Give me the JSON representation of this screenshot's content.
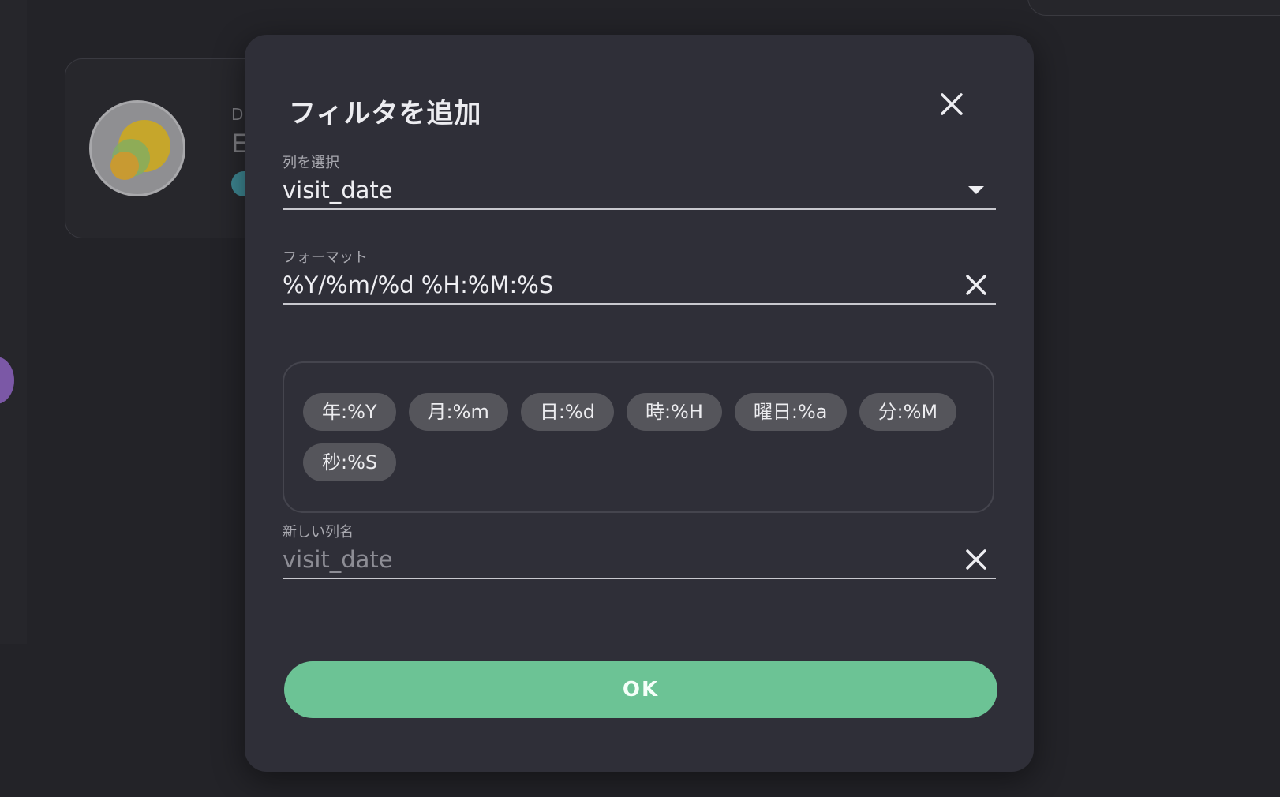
{
  "background": {
    "card_text_a": "D",
    "card_text_b": "E"
  },
  "dialog": {
    "title": "フィルタを追加",
    "close_icon": "close-icon",
    "column_field": {
      "label": "列を選択",
      "value": "visit_date",
      "icon": "dropdown-arrow-icon"
    },
    "format_field": {
      "label": "フォーマット",
      "value": "%Y/%m/%d %H:%M:%S",
      "icon": "clear-icon"
    },
    "format_chips": [
      {
        "label": "年:%Y"
      },
      {
        "label": "月:%m"
      },
      {
        "label": "日:%d"
      },
      {
        "label": "時:%H"
      },
      {
        "label": "曜日:%a"
      },
      {
        "label": "分:%M"
      },
      {
        "label": "秒:%S"
      }
    ],
    "new_column_field": {
      "label": "新しい列名",
      "placeholder": "visit_date",
      "icon": "clear-icon"
    },
    "ok_label": "OK"
  },
  "colors": {
    "dialog_bg": "#2f2f38",
    "page_bg": "#232328",
    "accent": "#6cc395",
    "chip_bg": "#55555b"
  }
}
